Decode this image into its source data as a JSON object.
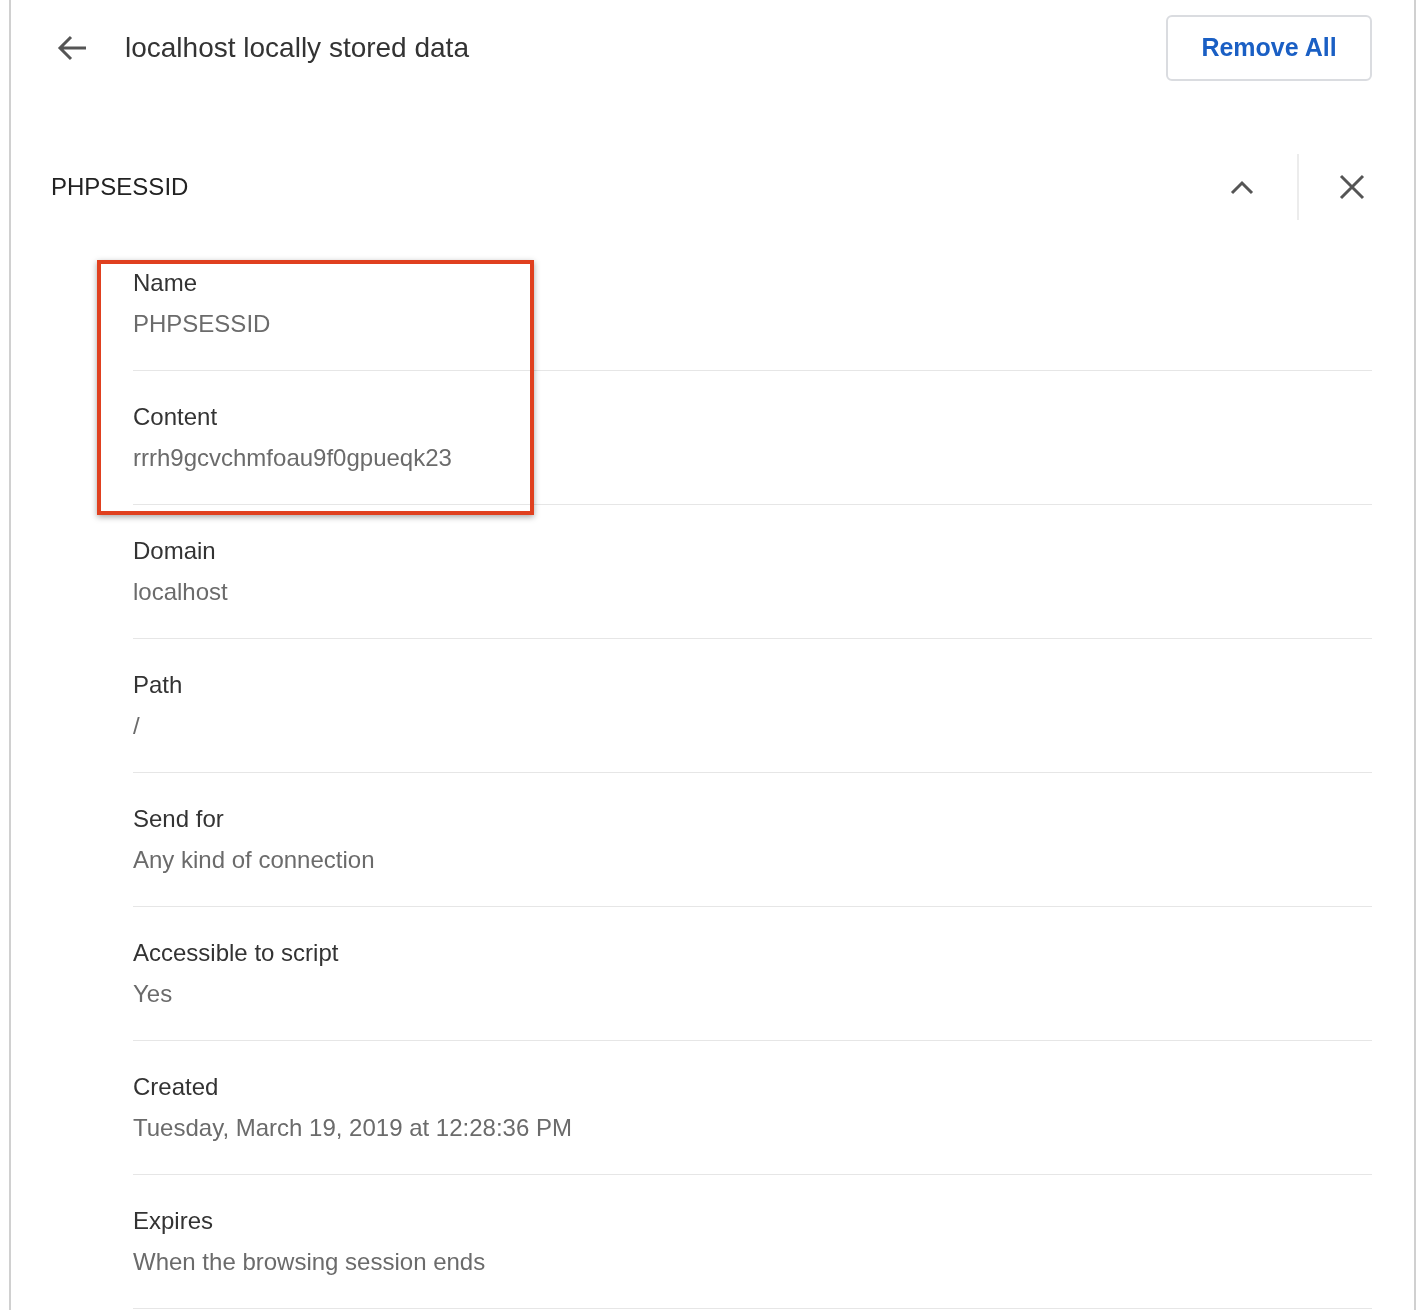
{
  "header": {
    "title": "localhost locally stored data",
    "button": "Remove All"
  },
  "cookie": {
    "name": "PHPSESSID",
    "expanded": true,
    "fields": [
      {
        "label": "Name",
        "value": "PHPSESSID",
        "highlighted": true
      },
      {
        "label": "Content",
        "value": "rrrh9gcvchmfoau9f0gpueqk23",
        "highlighted": true
      },
      {
        "label": "Domain",
        "value": "localhost",
        "highlighted": false
      },
      {
        "label": "Path",
        "value": "/",
        "highlighted": false
      },
      {
        "label": "Send for",
        "value": "Any kind of connection",
        "highlighted": false
      },
      {
        "label": "Accessible to script",
        "value": "Yes",
        "highlighted": false
      },
      {
        "label": "Created",
        "value": "Tuesday, March 19, 2019 at 12:28:36 PM",
        "highlighted": false
      },
      {
        "label": "Expires",
        "value": "When the browsing session ends",
        "highlighted": false
      }
    ]
  }
}
